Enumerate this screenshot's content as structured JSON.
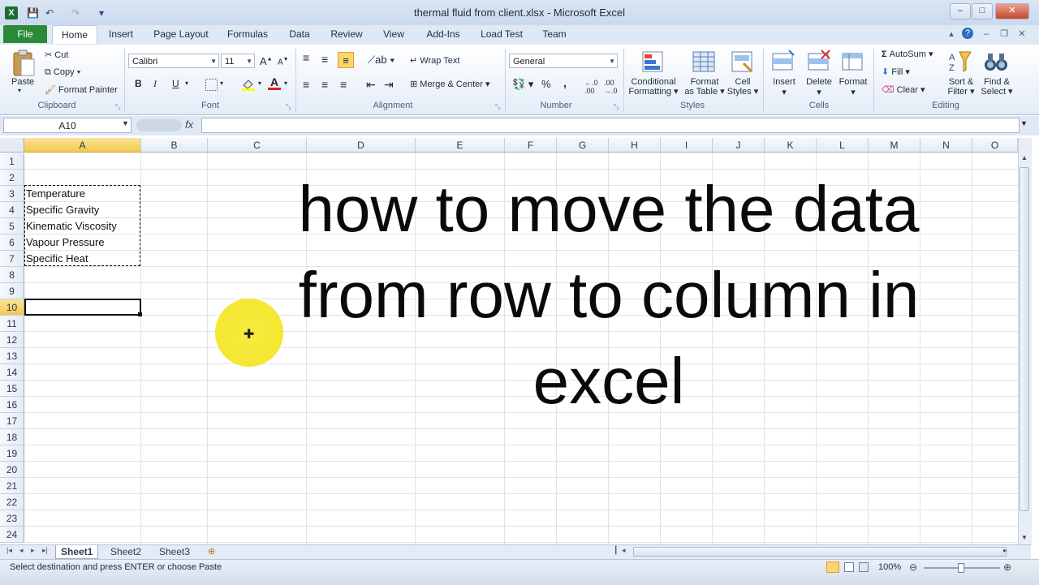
{
  "window": {
    "title": "thermal fluid from client.xlsx - Microsoft Excel",
    "app_icon": "X",
    "minimize": "–",
    "maximize": "□",
    "close": "✕"
  },
  "qat": {
    "save": "💾",
    "undo": "↶",
    "redo": "↷",
    "customize": "▾"
  },
  "tabs": {
    "file": "File",
    "items": [
      "Home",
      "Insert",
      "Page Layout",
      "Formulas",
      "Data",
      "Review",
      "View",
      "Add-Ins",
      "Load Test",
      "Team"
    ]
  },
  "ribbon": {
    "clipboard": {
      "label": "Clipboard",
      "paste": "Paste",
      "cut": "Cut",
      "copy": "Copy",
      "format_painter": "Format Painter"
    },
    "font": {
      "label": "Font",
      "font_name": "Calibri",
      "font_size": "11",
      "bold": "B",
      "italic": "I",
      "underline": "U",
      "grow": "A",
      "shrink": "A"
    },
    "alignment": {
      "label": "Alignment",
      "wrap_text": "Wrap Text",
      "merge_center": "Merge & Center"
    },
    "number": {
      "label": "Number",
      "format": "General",
      "percent": "%",
      "comma": ","
    },
    "styles": {
      "label": "Styles",
      "conditional_formatting": [
        "Conditional",
        "Formatting"
      ],
      "format_as_table": [
        "Format",
        "as Table"
      ],
      "cell_styles": [
        "Cell",
        "Styles"
      ]
    },
    "cells": {
      "label": "Cells",
      "insert": "Insert",
      "delete": "Delete",
      "format": "Format"
    },
    "editing": {
      "label": "Editing",
      "autosum": "AutoSum",
      "fill": "Fill",
      "clear": "Clear",
      "sort_filter": [
        "Sort &",
        "Filter"
      ],
      "find_select": [
        "Find &",
        "Select"
      ]
    }
  },
  "formula_bar": {
    "name_box": "A10",
    "fx": "fx",
    "value": ""
  },
  "columns": [
    "A",
    "B",
    "C",
    "D",
    "E",
    "F",
    "G",
    "H",
    "I",
    "J",
    "K",
    "L",
    "M",
    "N",
    "O"
  ],
  "rows": [
    "1",
    "2",
    "3",
    "4",
    "5",
    "6",
    "7",
    "8",
    "9",
    "10",
    "11",
    "12",
    "13",
    "14",
    "15",
    "16",
    "17",
    "18",
    "19",
    "20",
    "21",
    "22",
    "23",
    "24"
  ],
  "cells": [
    {
      "ref": "A3",
      "value": "Temperature"
    },
    {
      "ref": "A4",
      "value": "Specific  Gravity"
    },
    {
      "ref": "A5",
      "value": "Kinematic Viscosity"
    },
    {
      "ref": "A6",
      "value": "Vapour Pressure"
    },
    {
      "ref": "A7",
      "value": "Specific Heat"
    }
  ],
  "overlay": {
    "line1": "how to move the data",
    "line2": "from row to column in",
    "line3": "excel"
  },
  "sheets": [
    "Sheet1",
    "Sheet2",
    "Sheet3"
  ],
  "status": {
    "message": "Select destination and press ENTER or choose Paste",
    "zoom": "100%"
  },
  "colors": {
    "file_tab": "#2a8a3a",
    "active_header": "#f3c94c",
    "cursor_highlight": "#f3e21a"
  }
}
